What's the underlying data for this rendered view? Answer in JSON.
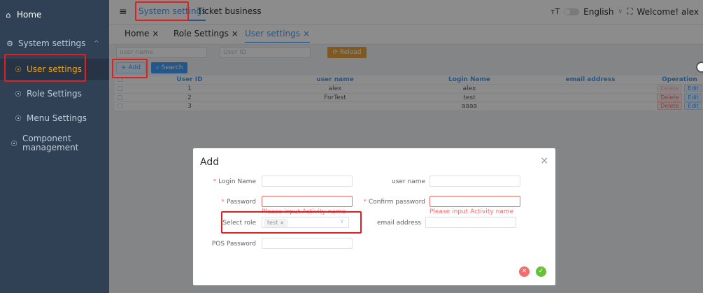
{
  "sidebar": {
    "home": "Home",
    "system_settings": "System settings",
    "user_settings": "User settings",
    "role_settings": "Role Settings",
    "menu_settings": "Menu Settings",
    "component_management_1": "Component",
    "component_management_2": "management"
  },
  "navbar": {
    "tab_system": "System settings",
    "tab_ticket": "Ticket business",
    "language": "English",
    "welcome": "Welcome! alex"
  },
  "page_tabs": {
    "home": "Home ×",
    "role": "Role Settings ×",
    "user": "User settings ×"
  },
  "filters": {
    "user_name_placeholder": "user name",
    "user_id_placeholder": "User ID",
    "reload": "Reload",
    "add": "+ Add",
    "search": "Search"
  },
  "table": {
    "headers": [
      "User ID",
      "user name",
      "Login Name",
      "email address",
      "Operation"
    ],
    "rows": [
      {
        "id": "1",
        "name": "alex",
        "login": "alex",
        "email": ""
      },
      {
        "id": "2",
        "name": "ForTest",
        "login": "test",
        "email": ""
      },
      {
        "id": "3",
        "name": "",
        "login": "aaaa",
        "email": ""
      }
    ],
    "delete": "Delete",
    "edit": "Edit"
  },
  "dialog": {
    "title": "Add",
    "close": "×",
    "login_name_label": "Login Name",
    "user_name_label": "user name",
    "password_label": "Password",
    "confirm_password_label": "Confirm password",
    "password_error": "Please input Activity name",
    "confirm_error": "Please input Activity name",
    "select_role_label": "Select role",
    "role_tag": "test ×",
    "email_label": "email address",
    "pos_password_label": "POS Password"
  },
  "colors": {
    "sidebar_bg": "#304156",
    "active_menu": "#f4a40c",
    "primary": "#409eff",
    "danger": "#f56c6c",
    "success": "#67c23a",
    "annotation": "#e02020"
  }
}
